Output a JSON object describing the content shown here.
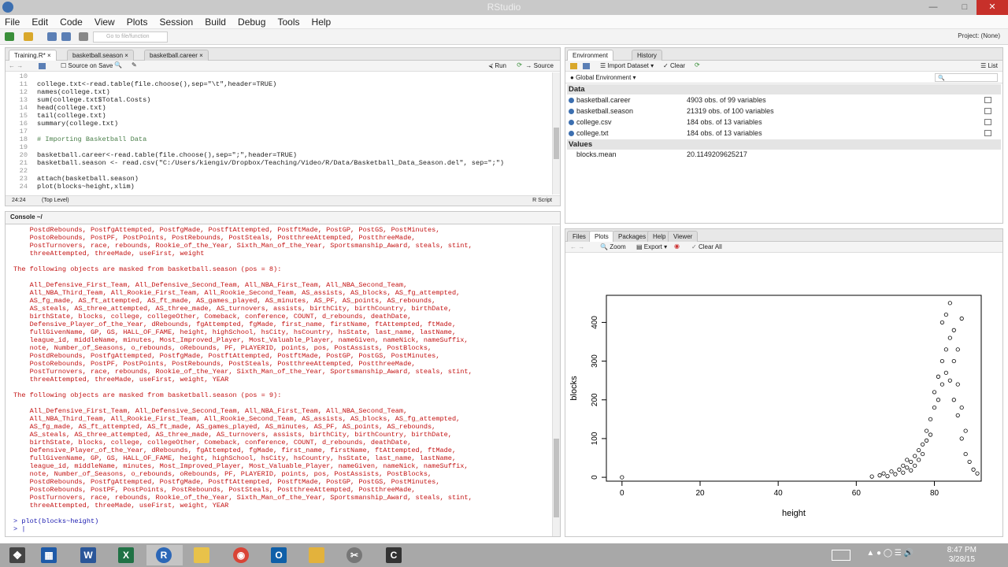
{
  "window": {
    "title": "RStudio"
  },
  "menu": [
    "File",
    "Edit",
    "Code",
    "View",
    "Plots",
    "Session",
    "Build",
    "Debug",
    "Tools",
    "Help"
  ],
  "toolbar": {
    "goto_placeholder": "Go to file/function",
    "project": "Project: (None)"
  },
  "editor": {
    "tabs": [
      "Training.R*",
      "basketball.season",
      "basketball.career"
    ],
    "source_on_save": "Source on Save",
    "run": "Run",
    "source": "Source",
    "lines": [
      {
        "n": "10",
        "t": ""
      },
      {
        "n": "11",
        "t": "college.txt<-read.table(file.choose(),sep=\"\\t\",header=TRUE)"
      },
      {
        "n": "12",
        "t": "names(college.txt)"
      },
      {
        "n": "13",
        "t": "sum(college.txt$Total.Costs)"
      },
      {
        "n": "14",
        "t": "head(college.txt)"
      },
      {
        "n": "15",
        "t": "tail(college.txt)"
      },
      {
        "n": "16",
        "t": "summary(college.txt)"
      },
      {
        "n": "17",
        "t": ""
      },
      {
        "n": "18",
        "t": "# Importing Basketball Data"
      },
      {
        "n": "19",
        "t": ""
      },
      {
        "n": "20",
        "t": "basketball.career<-read.table(file.choose(),sep=\";\",header=TRUE)"
      },
      {
        "n": "21",
        "t": "basketball.season <- read.csv(\"C:/Users/kiengiv/Dropbox/Teaching/Video/R/Data/Basketball_Data_Season.del\", sep=\";\")"
      },
      {
        "n": "22",
        "t": ""
      },
      {
        "n": "23",
        "t": "attach(basketball.season)"
      },
      {
        "n": "24",
        "t": "plot(blocks~height,xlim)"
      }
    ],
    "status_pos": "24:24",
    "status_scope": "(Top Level)",
    "status_type": "R Script"
  },
  "console": {
    "title": "Console ~/",
    "lines": [
      {
        "c": "red",
        "t": "    PostdRebounds, PostfgAttempted, PostfgMade, PostftAttempted, PostftMade, PostGP, PostGS, PostMinutes,"
      },
      {
        "c": "red",
        "t": "    PostoRebounds, PostPF, PostPoints, PostRebounds, PostSteals, PostthreeAttempted, PostthreeMade,"
      },
      {
        "c": "red",
        "t": "    PostTurnovers, race, rebounds, Rookie_of_the_Year, Sixth_Man_of_the_Year, Sportsmanship_Award, steals, stint,"
      },
      {
        "c": "red",
        "t": "    threeAttempted, threeMade, useFirst, weight"
      },
      {
        "c": "red",
        "t": ""
      },
      {
        "c": "red",
        "t": "The following objects are masked from basketball.season (pos = 8):"
      },
      {
        "c": "red",
        "t": ""
      },
      {
        "c": "red",
        "t": "    All_Defensive_First_Team, All_Defensive_Second_Team, All_NBA_First_Team, All_NBA_Second_Team,"
      },
      {
        "c": "red",
        "t": "    All_NBA_Third_Team, All_Rookie_First_Team, All_Rookie_Second_Team, AS_assists, AS_blocks, AS_fg_attempted,"
      },
      {
        "c": "red",
        "t": "    AS_fg_made, AS_ft_attempted, AS_ft_made, AS_games_played, AS_minutes, AS_PF, AS_points, AS_rebounds,"
      },
      {
        "c": "red",
        "t": "    AS_steals, AS_three_attempted, AS_three_made, AS_turnovers, assists, birthCity, birthCountry, birthDate,"
      },
      {
        "c": "red",
        "t": "    birthState, blocks, college, collegeOther, Comeback, conference, COUNT, d_rebounds, deathDate,"
      },
      {
        "c": "red",
        "t": "    Defensive_Player_of_the_Year, dRebounds, fgAttempted, fgMade, first_name, firstName, ftAttempted, ftMade,"
      },
      {
        "c": "red",
        "t": "    fullGivenName, GP, GS, HALL_OF_FAME, height, highSchool, hsCity, hsCountry, hsState, last_name, lastName,"
      },
      {
        "c": "red",
        "t": "    league_id, middleName, minutes, Most_Improved_Player, Most_Valuable_Player, nameGiven, nameNick, nameSuffix,"
      },
      {
        "c": "red",
        "t": "    note, Number_of_Seasons, o_rebounds, oRebounds, PF, PLAYERID, points, pos, PostAssists, PostBlocks,"
      },
      {
        "c": "red",
        "t": "    PostdRebounds, PostfgAttempted, PostfgMade, PostftAttempted, PostftMade, PostGP, PostGS, PostMinutes,"
      },
      {
        "c": "red",
        "t": "    PostoRebounds, PostPF, PostPoints, PostRebounds, PostSteals, PostthreeAttempted, PostthreeMade,"
      },
      {
        "c": "red",
        "t": "    PostTurnovers, race, rebounds, Rookie_of_the_Year, Sixth_Man_of_the_Year, Sportsmanship_Award, steals, stint,"
      },
      {
        "c": "red",
        "t": "    threeAttempted, threeMade, useFirst, weight, YEAR"
      },
      {
        "c": "red",
        "t": ""
      },
      {
        "c": "red",
        "t": "The following objects are masked from basketball.season (pos = 9):"
      },
      {
        "c": "red",
        "t": ""
      },
      {
        "c": "red",
        "t": "    All_Defensive_First_Team, All_Defensive_Second_Team, All_NBA_First_Team, All_NBA_Second_Team,"
      },
      {
        "c": "red",
        "t": "    All_NBA_Third_Team, All_Rookie_First_Team, All_Rookie_Second_Team, AS_assists, AS_blocks, AS_fg_attempted,"
      },
      {
        "c": "red",
        "t": "    AS_fg_made, AS_ft_attempted, AS_ft_made, AS_games_played, AS_minutes, AS_PF, AS_points, AS_rebounds,"
      },
      {
        "c": "red",
        "t": "    AS_steals, AS_three_attempted, AS_three_made, AS_turnovers, assists, birthCity, birthCountry, birthDate,"
      },
      {
        "c": "red",
        "t": "    birthState, blocks, college, collegeOther, Comeback, conference, COUNT, d_rebounds, deathDate,"
      },
      {
        "c": "red",
        "t": "    Defensive_Player_of_the_Year, dRebounds, fgAttempted, fgMade, first_name, firstName, ftAttempted, ftMade,"
      },
      {
        "c": "red",
        "t": "    fullGivenName, GP, GS, HALL_OF_FAME, height, highSchool, hsCity, hsCountry, hsState, last_name, lastName,"
      },
      {
        "c": "red",
        "t": "    league_id, middleName, minutes, Most_Improved_Player, Most_Valuable_Player, nameGiven, nameNick, nameSuffix,"
      },
      {
        "c": "red",
        "t": "    note, Number_of_Seasons, o_rebounds, oRebounds, PF, PLAYERID, points, pos, PostAssists, PostBlocks,"
      },
      {
        "c": "red",
        "t": "    PostdRebounds, PostfgAttempted, PostfgMade, PostftAttempted, PostftMade, PostGP, PostGS, PostMinutes,"
      },
      {
        "c": "red",
        "t": "    PostoRebounds, PostPF, PostPoints, PostRebounds, PostSteals, PostthreeAttempted, PostthreeMade,"
      },
      {
        "c": "red",
        "t": "    PostTurnovers, race, rebounds, Rookie_of_the_Year, Sixth_Man_of_the_Year, Sportsmanship_Award, steals, stint,"
      },
      {
        "c": "red",
        "t": "    threeAttempted, threeMade, useFirst, weight, YEAR"
      },
      {
        "c": "red",
        "t": ""
      },
      {
        "c": "blue",
        "t": "> plot(blocks~height)"
      },
      {
        "c": "blue",
        "t": "> |"
      }
    ]
  },
  "environment": {
    "tabs": [
      "Environment",
      "History"
    ],
    "import": "Import Dataset",
    "clear": "Clear",
    "list": "List",
    "scope": "Global Environment",
    "data_header": "Data",
    "data": [
      {
        "name": "basketball.career",
        "value": "4903 obs. of 99 variables"
      },
      {
        "name": "basketball.season",
        "value": "21319 obs. of 100 variables"
      },
      {
        "name": "college.csv",
        "value": "184 obs. of 13 variables"
      },
      {
        "name": "college.txt",
        "value": "184 obs. of 13 variables"
      }
    ],
    "values_header": "Values",
    "values": [
      {
        "name": "blocks.mean",
        "value": "20.1149209625217"
      }
    ]
  },
  "files_pane": {
    "tabs": [
      "Files",
      "Plots",
      "Packages",
      "Help",
      "Viewer"
    ],
    "zoom": "Zoom",
    "export": "Export",
    "clear_all": "Clear All"
  },
  "chart_data": {
    "type": "scatter",
    "title": "",
    "xlabel": "height",
    "ylabel": "blocks",
    "xlim": [
      -4,
      92
    ],
    "ylim": [
      -10,
      470
    ],
    "xticks": [
      0,
      20,
      40,
      60,
      80
    ],
    "yticks": [
      0,
      100,
      200,
      300,
      400
    ],
    "series": [
      {
        "points": [
          [
            0,
            0
          ],
          [
            64,
            2
          ],
          [
            66,
            5
          ],
          [
            67,
            10
          ],
          [
            68,
            3
          ],
          [
            69,
            15
          ],
          [
            70,
            8
          ],
          [
            71,
            20
          ],
          [
            72,
            12
          ],
          [
            72,
            30
          ],
          [
            73,
            25
          ],
          [
            73,
            45
          ],
          [
            74,
            40
          ],
          [
            74,
            18
          ],
          [
            75,
            55
          ],
          [
            75,
            30
          ],
          [
            76,
            70
          ],
          [
            76,
            45
          ],
          [
            77,
            85
          ],
          [
            77,
            60
          ],
          [
            78,
            120
          ],
          [
            78,
            95
          ],
          [
            79,
            150
          ],
          [
            79,
            110
          ],
          [
            80,
            220
          ],
          [
            80,
            180
          ],
          [
            81,
            260
          ],
          [
            81,
            200
          ],
          [
            82,
            300
          ],
          [
            82,
            240
          ],
          [
            83,
            330
          ],
          [
            83,
            270
          ],
          [
            84,
            360
          ],
          [
            84,
            250
          ],
          [
            85,
            300
          ],
          [
            85,
            200
          ],
          [
            86,
            240
          ],
          [
            86,
            160
          ],
          [
            87,
            180
          ],
          [
            87,
            100
          ],
          [
            88,
            120
          ],
          [
            88,
            60
          ],
          [
            89,
            40
          ],
          [
            90,
            20
          ],
          [
            91,
            10
          ],
          [
            82,
            400
          ],
          [
            83,
            420
          ],
          [
            84,
            450
          ],
          [
            85,
            380
          ],
          [
            86,
            330
          ],
          [
            87,
            410
          ]
        ]
      }
    ]
  },
  "taskbar": {
    "time": "8:47 PM",
    "date": "3/28/15"
  }
}
